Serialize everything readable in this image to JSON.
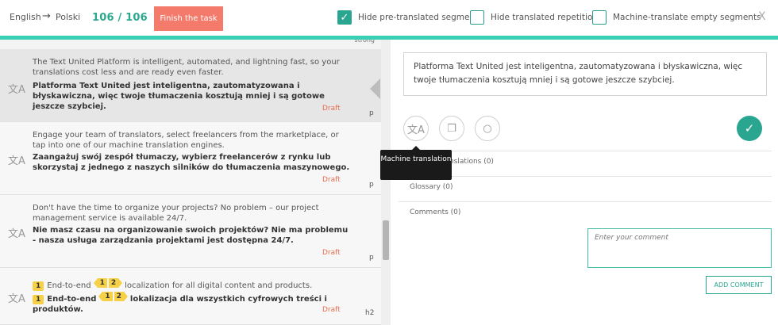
{
  "header": {
    "source_lang": "English",
    "arrow": "→",
    "target_lang": "Polski",
    "progress": "106 / 106",
    "finish_label": "Finish the task",
    "options": [
      {
        "label": "Hide pre-translated segments",
        "checked": true
      },
      {
        "label": "Hide translated repetitions",
        "checked": false
      },
      {
        "label": "Machine-translate empty segments",
        "checked": false
      }
    ],
    "close": "X",
    "accent_color": "#3ad0b5",
    "finish_color": "#f47b6b"
  },
  "segments": [
    {
      "source": "The Text United Platform is intelligent, automated, and lightning fast, so your translations cost less and are ready even faster.",
      "target": "Platforma Text United jest inteligentna, zautomatyzowana i błyskawiczna, więc twoje tłumaczenia kosztują mniej i są gotowe jeszcze szybciej.",
      "status": "Draft",
      "tag": "p",
      "active": true
    },
    {
      "source": "Engage your team of translators, select freelancers from the marketplace, or tap into one of our machine translation engines.",
      "target": "Zaangażuj swój zespół tłumaczy, wybierz freelancerów z rynku lub skorzystaj z jednego z naszych silników do tłumaczenia maszynowego.",
      "status": "Draft",
      "tag": "p",
      "active": false
    },
    {
      "source": "Don't have the time to organize your projects? No problem – our project management service is available 24/7.",
      "target": "Nie masz czasu na organizowanie swoich projektów? Nie ma problemu - nasza usługa zarządzania projektami jest dostępna 24/7.",
      "status": "Draft",
      "tag": "p",
      "active": false
    },
    {
      "source_parts": {
        "tag1": "1",
        "text1": "End-to-end",
        "tag_pair": [
          "1",
          "2"
        ],
        "text2": "localization for all digital content and products."
      },
      "target_parts": {
        "tag1": "1",
        "text1": "End-to-end",
        "tag_pair": [
          "1",
          "2"
        ],
        "text2": "lokalizacja dla wszystkich cyfrowych treści i produktów."
      },
      "status": "Draft",
      "tag": "h2",
      "active": false
    }
  ],
  "top_tag": "strong",
  "editor": {
    "target_text": "Platforma Text United jest inteligentna, zautomatyzowana i błyskawiczna, więc twoje tłumaczenia kosztują mniej i są gotowe jeszcze szybciej.",
    "tooltip": "Machine translation",
    "tm_label": "nslations (0)",
    "glossary_label": "Glossary (0)",
    "comments_label": "Comments (0)",
    "comment_placeholder": "Enter your comment",
    "add_comment_label": "ADD COMMENT"
  },
  "icons": {
    "mt": "translate-icon",
    "copy": "copy-icon",
    "comment": "comment-icon",
    "confirm": "check-icon"
  }
}
